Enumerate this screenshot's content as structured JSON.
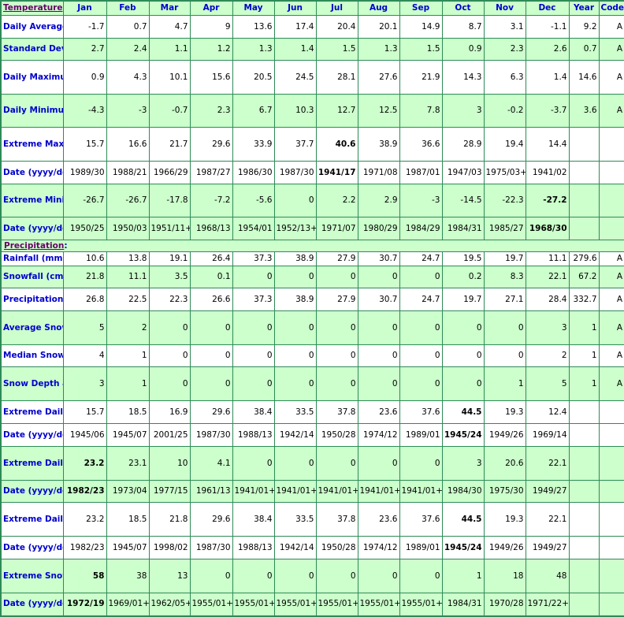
{
  "columns": [
    "Jan",
    "Feb",
    "Mar",
    "Apr",
    "May",
    "Jun",
    "Jul",
    "Aug",
    "Sep",
    "Oct",
    "Nov",
    "Dec",
    "Year",
    "Code"
  ],
  "sections": [
    {
      "title": "Temperature",
      "rows": [
        {
          "label": "Daily Average (°C)",
          "shade": "white",
          "values": [
            "-1.7",
            "0.7",
            "4.7",
            "9",
            "13.6",
            "17.4",
            "20.4",
            "20.1",
            "14.9",
            "8.7",
            "3.1",
            "-1.1",
            "9.2",
            "A"
          ],
          "bold": []
        },
        {
          "label": "Standard Deviation",
          "shade": "green",
          "values": [
            "2.7",
            "2.4",
            "1.1",
            "1.2",
            "1.3",
            "1.4",
            "1.5",
            "1.3",
            "1.5",
            "0.9",
            "2.3",
            "2.6",
            "0.7",
            "A"
          ],
          "bold": []
        },
        {
          "label": "Daily Maximum (°C)",
          "shade": "white",
          "values": [
            "0.9",
            "4.3",
            "10.1",
            "15.6",
            "20.5",
            "24.5",
            "28.1",
            "27.6",
            "21.9",
            "14.3",
            "6.3",
            "1.4",
            "14.6",
            "A"
          ],
          "bold": []
        },
        {
          "label": "Daily Minimum (°C)",
          "shade": "green",
          "values": [
            "-4.3",
            "-3",
            "-0.7",
            "2.3",
            "6.7",
            "10.3",
            "12.7",
            "12.5",
            "7.8",
            "3",
            "-0.2",
            "-3.7",
            "3.6",
            "A"
          ],
          "bold": []
        },
        {
          "label": "Extreme Maximum (°C)",
          "shade": "white",
          "thick_top": true,
          "values": [
            "15.7",
            "16.6",
            "21.7",
            "29.6",
            "33.9",
            "37.7",
            "40.6",
            "38.9",
            "36.6",
            "28.9",
            "19.4",
            "14.4",
            "",
            ""
          ],
          "bold": [
            6
          ]
        },
        {
          "label": "Date (yyyy/dd)",
          "shade": "white",
          "values": [
            "1989/30",
            "1988/21",
            "1966/29",
            "1987/27",
            "1986/30",
            "1987/30",
            "1941/17",
            "1971/08",
            "1987/01",
            "1947/03",
            "1975/03+",
            "1941/02",
            "",
            ""
          ],
          "bold": [
            6
          ]
        },
        {
          "label": "Extreme Minimum (°C)",
          "shade": "green",
          "values": [
            "-26.7",
            "-26.7",
            "-17.8",
            "-7.2",
            "-5.6",
            "0",
            "2.2",
            "2.9",
            "-3",
            "-14.5",
            "-22.3",
            "-27.2",
            "",
            ""
          ],
          "bold": [
            11
          ]
        },
        {
          "label": "Date (yyyy/dd)",
          "shade": "green",
          "values": [
            "1950/25",
            "1950/03",
            "1951/11+",
            "1968/13",
            "1954/01",
            "1952/13+",
            "1971/07",
            "1980/29",
            "1984/29",
            "1984/31",
            "1985/27",
            "1968/30",
            "",
            ""
          ],
          "bold": [
            11
          ]
        }
      ]
    },
    {
      "title": "Precipitation",
      "rows": [
        {
          "label": "Rainfall (mm)",
          "shade": "white",
          "values": [
            "10.6",
            "13.8",
            "19.1",
            "26.4",
            "37.3",
            "38.9",
            "27.9",
            "30.7",
            "24.7",
            "19.5",
            "19.7",
            "11.1",
            "279.6",
            "A"
          ],
          "bold": []
        },
        {
          "label": "Snowfall (cm)",
          "shade": "green",
          "values": [
            "21.8",
            "11.1",
            "3.5",
            "0.1",
            "0",
            "0",
            "0",
            "0",
            "0",
            "0.2",
            "8.3",
            "22.1",
            "67.2",
            "A"
          ],
          "bold": []
        },
        {
          "label": "Precipitation (mm)",
          "shade": "white",
          "values": [
            "26.8",
            "22.5",
            "22.3",
            "26.6",
            "37.3",
            "38.9",
            "27.9",
            "30.7",
            "24.7",
            "19.7",
            "27.1",
            "28.4",
            "332.7",
            "A"
          ],
          "bold": []
        },
        {
          "label": "Average Snow Depth (cm)",
          "shade": "green",
          "values": [
            "5",
            "2",
            "0",
            "0",
            "0",
            "0",
            "0",
            "0",
            "0",
            "0",
            "0",
            "3",
            "1",
            "A"
          ],
          "bold": []
        },
        {
          "label": "Median Snow Depth (cm)",
          "shade": "white",
          "values": [
            "4",
            "1",
            "0",
            "0",
            "0",
            "0",
            "0",
            "0",
            "0",
            "0",
            "0",
            "2",
            "1",
            "A"
          ],
          "bold": []
        },
        {
          "label": "Snow Depth at Month-end (cm)",
          "shade": "green",
          "values": [
            "3",
            "1",
            "0",
            "0",
            "0",
            "0",
            "0",
            "0",
            "0",
            "0",
            "1",
            "5",
            "1",
            "A"
          ],
          "bold": []
        },
        {
          "label": "Extreme Daily Rainfall (mm)",
          "shade": "white",
          "thick_top": true,
          "values": [
            "15.7",
            "18.5",
            "16.9",
            "29.6",
            "38.4",
            "33.5",
            "37.8",
            "23.6",
            "37.6",
            "44.5",
            "19.3",
            "12.4",
            "",
            ""
          ],
          "bold": [
            9
          ]
        },
        {
          "label": "Date (yyyy/dd)",
          "shade": "white",
          "values": [
            "1945/06",
            "1945/07",
            "2001/25",
            "1987/30",
            "1988/13",
            "1942/14",
            "1950/28",
            "1974/12",
            "1989/01",
            "1945/24",
            "1949/26",
            "1969/14",
            "",
            ""
          ],
          "bold": [
            9
          ]
        },
        {
          "label": "Extreme Daily Snowfall (cm)",
          "shade": "green",
          "values": [
            "23.2",
            "23.1",
            "10",
            "4.1",
            "0",
            "0",
            "0",
            "0",
            "0",
            "3",
            "20.6",
            "22.1",
            "",
            ""
          ],
          "bold": [
            0
          ]
        },
        {
          "label": "Date (yyyy/dd)",
          "shade": "green",
          "values": [
            "1982/23",
            "1973/04",
            "1977/15",
            "1961/13",
            "1941/01+",
            "1941/01+",
            "1941/01+",
            "1941/01+",
            "1941/01+",
            "1984/30",
            "1975/30",
            "1949/27",
            "",
            ""
          ],
          "bold": [
            0
          ]
        },
        {
          "label": "Extreme Daily Precipitation (mm)",
          "shade": "white",
          "values": [
            "23.2",
            "18.5",
            "21.8",
            "29.6",
            "38.4",
            "33.5",
            "37.8",
            "23.6",
            "37.6",
            "44.5",
            "19.3",
            "22.1",
            "",
            ""
          ],
          "bold": [
            9
          ]
        },
        {
          "label": "Date (yyyy/dd)",
          "shade": "white",
          "values": [
            "1982/23",
            "1945/07",
            "1998/02",
            "1987/30",
            "1988/13",
            "1942/14",
            "1950/28",
            "1974/12",
            "1989/01",
            "1945/24",
            "1949/26",
            "1949/27",
            "",
            ""
          ],
          "bold": [
            9
          ]
        },
        {
          "label": "Extreme Snow Depth (cm)",
          "shade": "green",
          "values": [
            "58",
            "38",
            "13",
            "0",
            "0",
            "0",
            "0",
            "0",
            "0",
            "1",
            "18",
            "48",
            "",
            ""
          ],
          "bold": [
            0
          ]
        },
        {
          "label": "Date (yyyy/dd)",
          "shade": "green",
          "values": [
            "1972/19",
            "1969/01+",
            "1962/05+",
            "1955/01+",
            "1955/01+",
            "1955/01+",
            "1955/01+",
            "1955/01+",
            "1955/01+",
            "1984/31",
            "1970/28",
            "1971/22+",
            "",
            ""
          ],
          "bold": [
            0
          ]
        }
      ]
    }
  ]
}
